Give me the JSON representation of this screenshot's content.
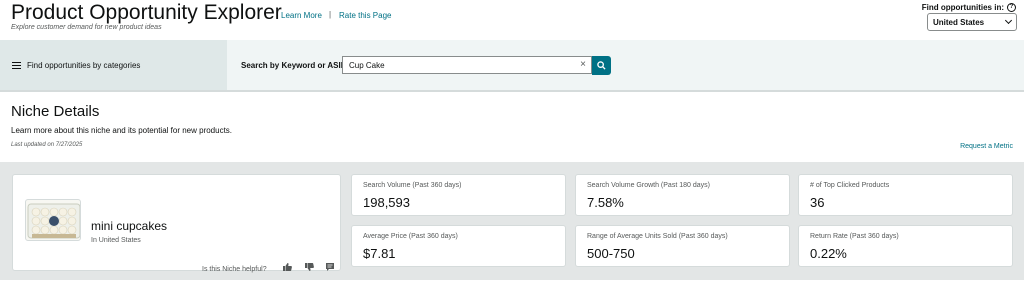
{
  "header": {
    "title": "Product Opportunity Explorer",
    "subtitle": "Explore customer demand for new product ideas",
    "learn_more": "Learn More",
    "separator": "|",
    "rate_page": "Rate this Page",
    "find_label": "Find opportunities in:",
    "help_icon": "?",
    "country": "United States"
  },
  "search": {
    "categories_label": "Find opportunities by categories",
    "search_label": "Search by Keyword or ASIN",
    "value": "Cup Cake",
    "clear_icon": "×"
  },
  "niche": {
    "section_title": "Niche Details",
    "description": "Learn more about this niche and its potential for new products.",
    "last_updated": "Last updated on 7/27/2025",
    "request_metric": "Request a Metric",
    "name": "mini cupcakes",
    "country": "In United States",
    "helpful_prompt": "Is this Niche helpful?"
  },
  "metrics": [
    {
      "label": "Search Volume (Past 360 days)",
      "value": "198,593"
    },
    {
      "label": "Search Volume Growth (Past 180 days)",
      "value": "7.58%"
    },
    {
      "label": "# of Top Clicked Products",
      "value": "36"
    },
    {
      "label": "Average Price (Past 360 days)",
      "value": "$7.81"
    },
    {
      "label": "Range of Average Units Sold (Past 360 days)",
      "value": "500-750"
    },
    {
      "label": "Return Rate (Past 360 days)",
      "value": "0.22%"
    }
  ],
  "colors": {
    "link": "#007185",
    "search_button": "#007185",
    "band": "#f0f5f5",
    "gray_area": "#e3e6e6"
  }
}
